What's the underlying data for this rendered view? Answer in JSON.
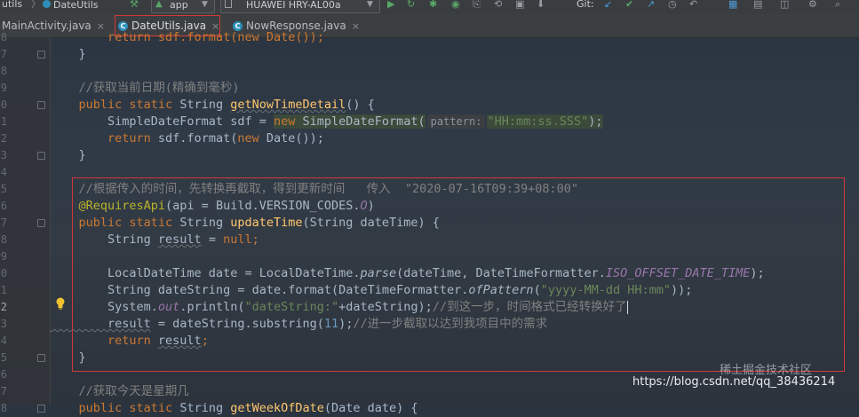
{
  "toolbar": {
    "breadcrumb_1": "utils",
    "breadcrumb_2": "DateUtils",
    "run_config": "app",
    "device": "HUAWEI HRY-AL00a",
    "git_label": "Git:"
  },
  "tabs": [
    {
      "label": "MainActivity.java"
    },
    {
      "label": "DateUtils.java"
    },
    {
      "label": "NowResponse.java"
    }
  ],
  "line_numbers": [
    "8",
    "7",
    "8",
    "9",
    "0",
    "1",
    "2",
    "3",
    "4",
    "5",
    "6",
    "7",
    "8",
    "9",
    "0",
    "1",
    "2",
    "3",
    "4",
    "5",
    "6",
    "7",
    "8"
  ],
  "code": {
    "l0": {
      "a": "        return sdf.format(new Date());"
    },
    "l1": {
      "a": "    }"
    },
    "l2": {
      "a": ""
    },
    "l3": {
      "cm": "    //获取当前日期(精确到毫秒)"
    },
    "l4": {
      "kw1": "    public static ",
      "t": "String ",
      "fn": "getNowTimeDetail",
      "rest": "() {"
    },
    "l5": {
      "a": "        SimpleDateFormat sdf = ",
      "kw": "new ",
      "b": "SimpleDateFormat(",
      "hint": "pattern:",
      "st": "\"HH:mm:ss.SSS\"",
      "c": ");"
    },
    "l6": {
      "kw": "        return ",
      "a": "sdf.format(",
      "kw2": "new ",
      "b": "Date());"
    },
    "l7": {
      "a": "    }"
    },
    "l8": {
      "a": ""
    },
    "l9": {
      "cm": "    //根据传入的时间，先转换再截取，得到更新时间   传入  \"2020-07-16T09:39+08:00\""
    },
    "l10": {
      "an": "    @RequiresApi",
      "a": "(api = Build.VERSION_CODES.",
      "it": "O",
      "b": ")"
    },
    "l11": {
      "kw": "    public static ",
      "a": "String ",
      "fn": "updateTime",
      "b": "(String dateTime) {"
    },
    "l12": {
      "a": "        String ",
      "v": "result",
      "b": " = ",
      "kw": "null",
      "c": ";"
    },
    "l13": {
      "a": ""
    },
    "l14": {
      "a": "        LocalDateTime date = LocalDateTime.",
      "it": "parse",
      "b": "(dateTime, DateTimeFormatter.",
      "cn": "ISO_OFFSET_DATE_TIME",
      "c": ");"
    },
    "l15": {
      "a": "        String dateString = date.format(DateTimeFormatter.",
      "it": "ofPattern",
      "b": "(",
      "st": "\"yyyy-MM-dd HH:mm\"",
      "c": "));"
    },
    "l16": {
      "a": "        System.",
      "cn": "out",
      "b": ".println(",
      "st": "\"dateString:\"",
      "c": "+dateString);",
      "cm": "//到这一步，时间格式已经转换好了"
    },
    "l17": {
      "v": "        result",
      "a": " = dateString.substring(",
      "num": "11",
      "b": ");",
      "cm": "//进一步截取以达到我项目中的需求"
    },
    "l18": {
      "kw": "        return ",
      "v": "result",
      "a": ";"
    },
    "l19": {
      "a": "    }"
    },
    "l20": {
      "a": ""
    },
    "l21": {
      "cm": "    //获取今天是星期几"
    },
    "l22": {
      "kw": "    public static ",
      "a": "String ",
      "fn": "getWeekOfDate",
      "b": "(Date date) {"
    }
  },
  "watermark": "https://blog.csdn.net/qq_38436214",
  "watermark_badge": "稀土掘金技术社区",
  "colors": {
    "keyword": "#cc7832",
    "comment": "#808080",
    "string": "#6a8759",
    "function": "#ffc66d",
    "annotation": "#bbb529",
    "highlight_box": "#d1383a"
  }
}
